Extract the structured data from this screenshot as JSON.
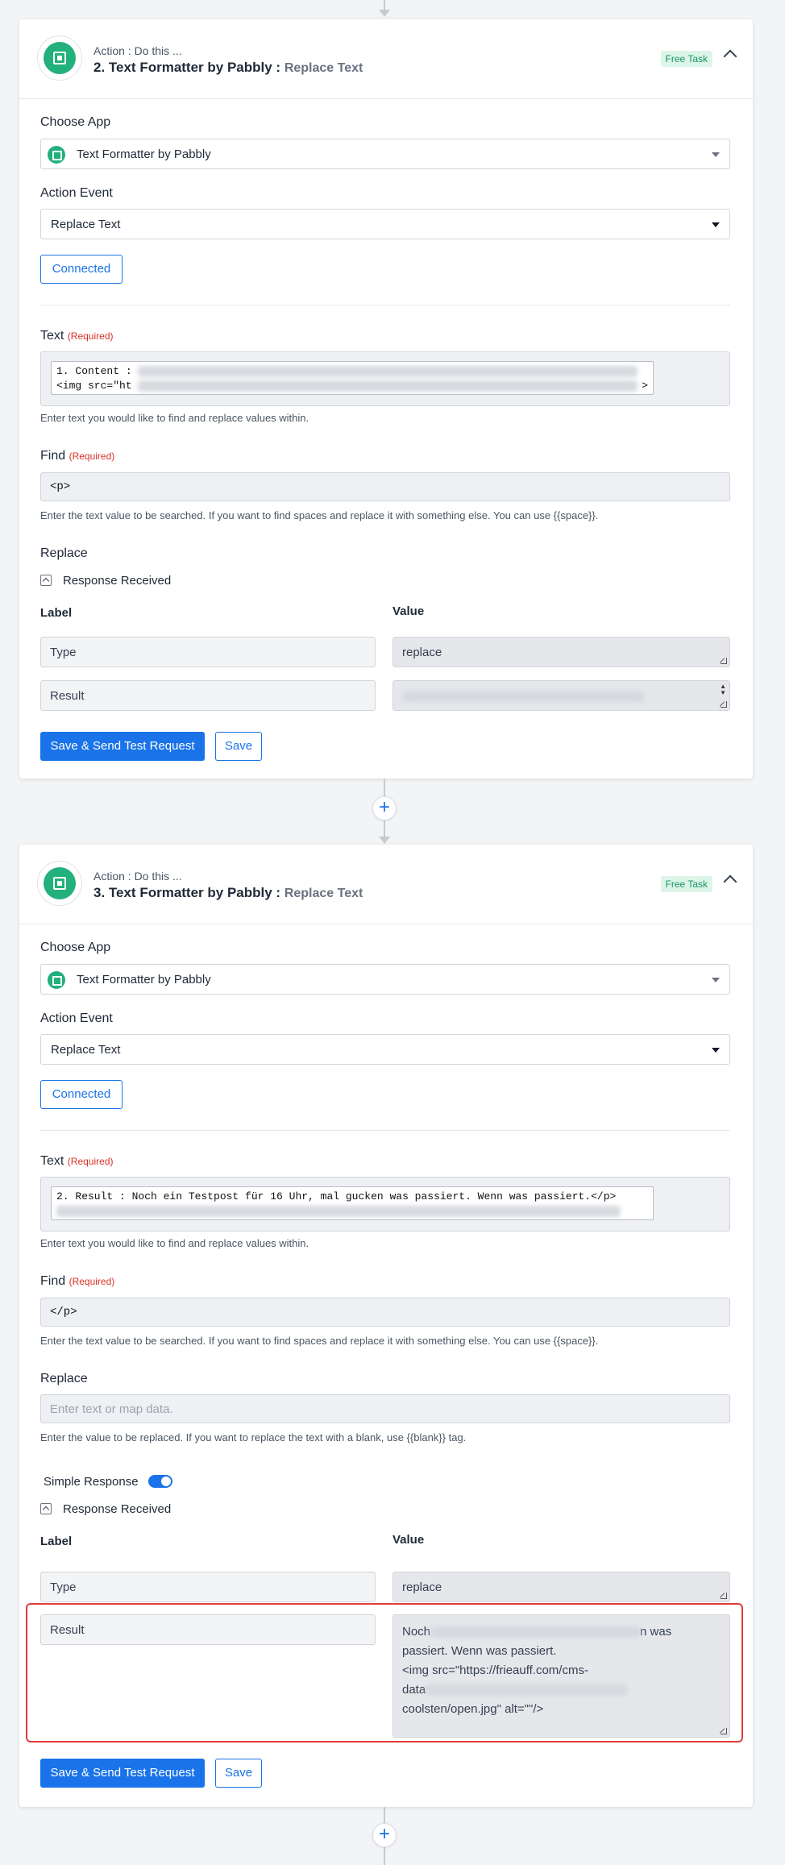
{
  "steps": [
    {
      "subtitle": "Action : Do this ...",
      "title_prefix": "2. Text Formatter by Pabbly :",
      "title_event": "Replace Text",
      "badge": "Free Task",
      "choose_app_label": "Choose App",
      "app_name": "Text Formatter by Pabbly",
      "action_event_label": "Action Event",
      "action_event": "Replace Text",
      "connected_label": "Connected",
      "text_label": "Text",
      "required": "(Required)",
      "text_line1": "1. Content :",
      "text_line2": "<img src=\"ht",
      "text_help": "Enter text you would like to find and replace values within.",
      "find_label": "Find",
      "find_value": "<p>",
      "find_help": "Enter the text value to be searched. If you want to find spaces and replace it with something else. You can use {{space}}.",
      "replace_label": "Replace",
      "response_label": "Response Received",
      "col_label": "Label",
      "col_value": "Value",
      "row1_label": "Type",
      "row1_value": "replace",
      "row2_label": "Result",
      "send_btn": "Save & Send Test Request",
      "save_btn": "Save"
    },
    {
      "subtitle": "Action : Do this ...",
      "title_prefix": "3. Text Formatter by Pabbly :",
      "title_event": "Replace Text",
      "badge": "Free Task",
      "choose_app_label": "Choose App",
      "app_name": "Text Formatter by Pabbly",
      "action_event_label": "Action Event",
      "action_event": "Replace Text",
      "connected_label": "Connected",
      "text_label": "Text",
      "required": "(Required)",
      "text_line1": "2. Result : Noch ein Testpost für 16 Uhr, mal gucken was passiert. Wenn was passiert.</p>",
      "text_help": "Enter text you would like to find and replace values within.",
      "find_label": "Find",
      "find_value": "</p>",
      "find_help": "Enter the text value to be searched. If you want to find spaces and replace it with something else. You can use {{space}}.",
      "replace_label": "Replace",
      "replace_placeholder": "Enter text or map data.",
      "replace_help": "Enter the value to be replaced. If you want to replace the text with a blank, use {{blank}} tag.",
      "simple_response_label": "Simple Response",
      "response_label": "Response Received",
      "col_label": "Label",
      "col_value": "Value",
      "row1_label": "Type",
      "row1_value": "replace",
      "row2_label": "Result",
      "result_l1a": "Noch",
      "result_l1b": "n was",
      "result_l2": "passiert. Wenn was passiert.",
      "result_l3": "<img src=\"https://frieauff.com/cms-",
      "result_l4": "data",
      "result_l5": "coolsten/open.jpg\" alt=\"\"/>",
      "send_btn": "Save & Send Test Request",
      "save_btn": "Save"
    }
  ],
  "add_step_symbol": "+",
  "colors": {
    "accent": "#1a73e8",
    "app_green": "#22b07d",
    "badge_bg": "#dcf5e9",
    "required_red": "#d93025",
    "highlight": "#e03a3a"
  }
}
